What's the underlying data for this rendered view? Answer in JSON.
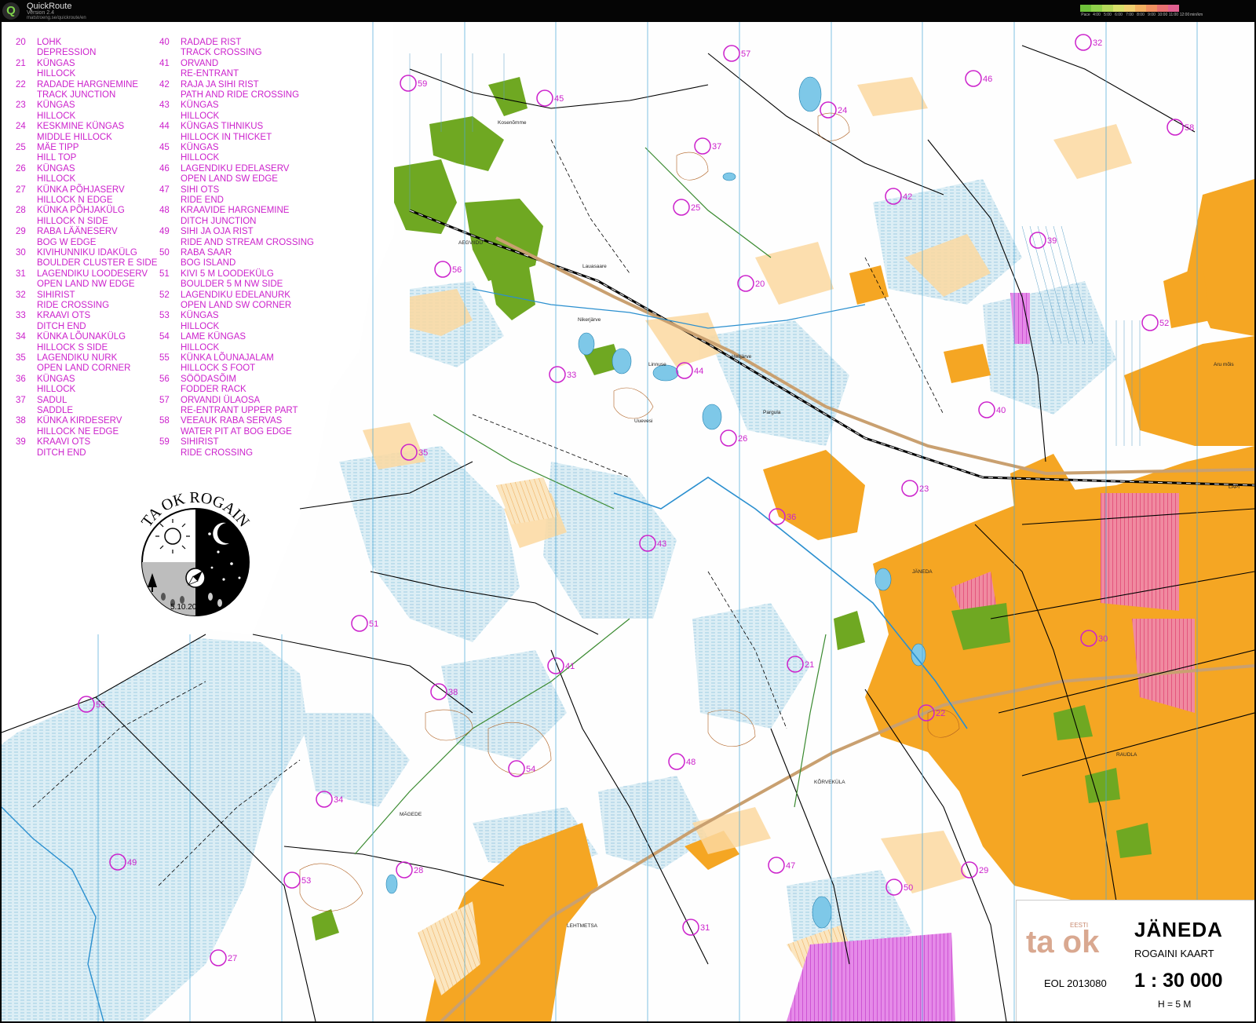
{
  "window": {
    "app_name": "QuickRoute",
    "version": "Version 2.4",
    "url": "matstroeng.se/quickroute/en",
    "pace_scale": {
      "prefix": "Pace",
      "ticks": [
        "4:00",
        "5:00",
        "6:00",
        "7:00",
        "8:00",
        "9:00",
        "10:00",
        "11:00",
        "12:00",
        "min/km"
      ],
      "colors": [
        "#6fc23a",
        "#8fd14a",
        "#b5d95a",
        "#d8e06a",
        "#f0d070",
        "#f2b060",
        "#f09060",
        "#e87070",
        "#e06090"
      ]
    }
  },
  "legend": {
    "items": [
      {
        "num": "20",
        "est": "LOHK",
        "eng": "DEPRESSION"
      },
      {
        "num": "21",
        "est": "KÜNGAS",
        "eng": "HILLOCK"
      },
      {
        "num": "22",
        "est": "RADADE HARGNEMINE",
        "eng": "TRACK JUNCTION"
      },
      {
        "num": "23",
        "est": "KÜNGAS",
        "eng": "HILLOCK"
      },
      {
        "num": "24",
        "est": "KESKMINE KÜNGAS",
        "eng": "MIDDLE HILLOCK"
      },
      {
        "num": "25",
        "est": "MÄE TIPP",
        "eng": "HILL TOP"
      },
      {
        "num": "26",
        "est": "KÜNGAS",
        "eng": "HILLOCK"
      },
      {
        "num": "27",
        "est": "KÜNKA PÕHJASERV",
        "eng": "HILLOCK N EDGE"
      },
      {
        "num": "28",
        "est": "KÜNKA PÕHJAKÜLG",
        "eng": "HILLOCK N SIDE"
      },
      {
        "num": "29",
        "est": "RABA LÄÄNESERV",
        "eng": "BOG W EDGE"
      },
      {
        "num": "30",
        "est": "KIVIHUNNIKU IDAKÜLG",
        "eng": "BOULDER CLUSTER E SIDE"
      },
      {
        "num": "31",
        "est": "LAGENDIKU LOODESERV",
        "eng": "OPEN LAND NW EDGE"
      },
      {
        "num": "32",
        "est": "SIHIRIST",
        "eng": "RIDE CROSSING"
      },
      {
        "num": "33",
        "est": "KRAAVI OTS",
        "eng": "DITCH END"
      },
      {
        "num": "34",
        "est": "KÜNKA LÕUNAKÜLG",
        "eng": "HILLOCK S SIDE"
      },
      {
        "num": "35",
        "est": "LAGENDIKU NURK",
        "eng": "OPEN LAND CORNER"
      },
      {
        "num": "36",
        "est": "KÜNGAS",
        "eng": "HILLOCK"
      },
      {
        "num": "37",
        "est": "SADUL",
        "eng": "SADDLE"
      },
      {
        "num": "38",
        "est": "KÜNKA KIRDESERV",
        "eng": "HILLOCK NE EDGE"
      },
      {
        "num": "39",
        "est": "KRAAVI OTS",
        "eng": "DITCH END"
      },
      {
        "num": "40",
        "est": "RADADE RIST",
        "eng": "TRACK CROSSING"
      },
      {
        "num": "41",
        "est": "ORVAND",
        "eng": "RE-ENTRANT"
      },
      {
        "num": "42",
        "est": "RAJA JA SIHI RIST",
        "eng": "PATH AND RIDE CROSSING"
      },
      {
        "num": "43",
        "est": "KÜNGAS",
        "eng": "HILLOCK"
      },
      {
        "num": "44",
        "est": "KÜNGAS TIHNIKUS",
        "eng": "HILLOCK IN THICKET"
      },
      {
        "num": "45",
        "est": "KÜNGAS",
        "eng": "HILLOCK"
      },
      {
        "num": "46",
        "est": "LAGENDIKU EDELASERV",
        "eng": "OPEN LAND SW EDGE"
      },
      {
        "num": "47",
        "est": "SIHI OTS",
        "eng": "RIDE END"
      },
      {
        "num": "48",
        "est": "KRAAVIDE HARGNEMINE",
        "eng": "DITCH JUNCTION"
      },
      {
        "num": "49",
        "est": "SIHI JA OJA RIST",
        "eng": "RIDE AND STREAM CROSSING"
      },
      {
        "num": "50",
        "est": "RABA SAAR",
        "eng": "BOG ISLAND"
      },
      {
        "num": "51",
        "est": "KIVI 5 M LOODEKÜLG",
        "eng": "BOULDER 5 M NW SIDE"
      },
      {
        "num": "52",
        "est": "LAGENDIKU EDELANURK",
        "eng": "OPEN LAND SW CORNER"
      },
      {
        "num": "53",
        "est": "KÜNGAS",
        "eng": "HILLOCK"
      },
      {
        "num": "54",
        "est": "LAME KÜNGAS",
        "eng": "HILLOCK"
      },
      {
        "num": "55",
        "est": "KÜNKA LÕUNAJALAM",
        "eng": "HILLOCK S FOOT"
      },
      {
        "num": "56",
        "est": "SÖÖDASÕIM",
        "eng": "FODDER RACK"
      },
      {
        "num": "57",
        "est": "ORVANDI ÜLAOSA",
        "eng": "RE-ENTRANT UPPER PART"
      },
      {
        "num": "58",
        "est": "VEEAUK RABA SERVAS",
        "eng": "WATER PIT AT BOG EDGE"
      },
      {
        "num": "59",
        "est": "SIHIRIST",
        "eng": "RIDE CROSSING"
      }
    ]
  },
  "logo": {
    "title": "TA OK ROGAIN",
    "date": "5.10.2013"
  },
  "map_info": {
    "brand_small": "EESTI",
    "brand": "ta ok",
    "title": "JÄNEDA",
    "subtitle": "ROGAINI KAART",
    "scale": "1 : 30 000",
    "contour_interval": "H = 5 M",
    "eol_code": "EOL 2013080"
  },
  "controls": [
    {
      "num": "57",
      "pos": "upper-mid"
    },
    {
      "num": "59",
      "pos": "upper-left"
    },
    {
      "num": "45",
      "pos": "upper-left"
    },
    {
      "num": "46",
      "pos": "upper-right"
    },
    {
      "num": "32",
      "pos": "upper-right"
    },
    {
      "num": "24",
      "pos": "upper-mid"
    },
    {
      "num": "58",
      "pos": "upper-right"
    },
    {
      "num": "37",
      "pos": "upper-mid"
    },
    {
      "num": "42",
      "pos": "upper-mid"
    },
    {
      "num": "25",
      "pos": "upper-mid"
    },
    {
      "num": "56",
      "pos": "left"
    },
    {
      "num": "39",
      "pos": "upper-right"
    },
    {
      "num": "20",
      "pos": "mid"
    },
    {
      "num": "52",
      "pos": "right"
    },
    {
      "num": "33",
      "pos": "mid"
    },
    {
      "num": "44",
      "pos": "mid"
    },
    {
      "num": "40",
      "pos": "right"
    },
    {
      "num": "26",
      "pos": "mid"
    },
    {
      "num": "35",
      "pos": "left"
    },
    {
      "num": "23",
      "pos": "right"
    },
    {
      "num": "36",
      "pos": "mid"
    },
    {
      "num": "43",
      "pos": "mid"
    },
    {
      "num": "30",
      "pos": "right"
    },
    {
      "num": "51",
      "pos": "left"
    },
    {
      "num": "41",
      "pos": "mid"
    },
    {
      "num": "21",
      "pos": "mid"
    },
    {
      "num": "55",
      "pos": "left"
    },
    {
      "num": "38",
      "pos": "mid"
    },
    {
      "num": "22",
      "pos": "right"
    },
    {
      "num": "48",
      "pos": "mid"
    },
    {
      "num": "54",
      "pos": "mid"
    },
    {
      "num": "34",
      "pos": "left"
    },
    {
      "num": "49",
      "pos": "left"
    },
    {
      "num": "47",
      "pos": "mid"
    },
    {
      "num": "29",
      "pos": "right"
    },
    {
      "num": "53",
      "pos": "left"
    },
    {
      "num": "28",
      "pos": "left"
    },
    {
      "num": "50",
      "pos": "right"
    },
    {
      "num": "31",
      "pos": "mid"
    },
    {
      "num": "27",
      "pos": "left"
    }
  ],
  "place_names": [
    "Kosenõmme",
    "AEGVIIDU",
    "Lauasaare",
    "Nikerjärve",
    "Linnuse",
    "Uuevesi",
    "Pargula",
    "Helljärve",
    "JÄNEDA",
    "RAUDLA",
    "KÕRVEKÜLA",
    "MÄGEDE",
    "LEHTMETSA",
    "LAPI",
    "Aru mõis"
  ],
  "colors": {
    "control_magenta": "#cc22cc",
    "open_land": "#f5a623",
    "water": "#7ec8e8",
    "green": "#6fa822",
    "cultivated": "#e8607a",
    "restricted": "#d844d8"
  }
}
